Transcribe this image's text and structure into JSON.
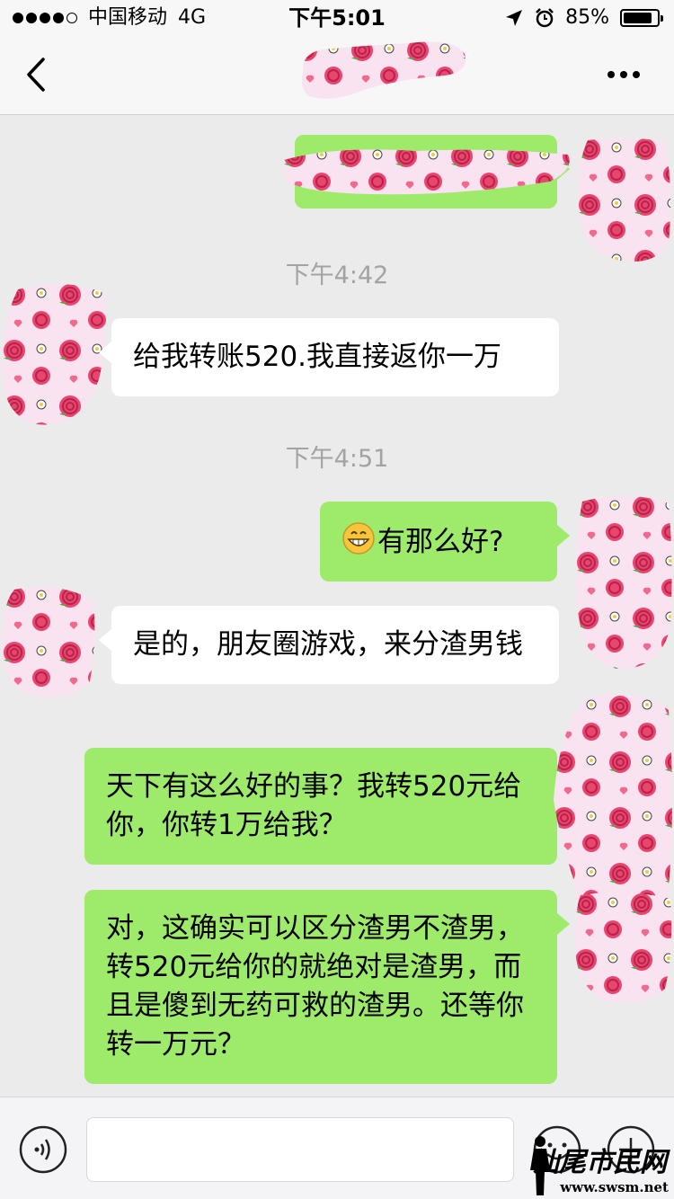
{
  "status_bar": {
    "carrier": "中国移动",
    "network": "4G",
    "time": "下午5:01",
    "battery": "85%",
    "battery_level": 0.85
  },
  "chat": {
    "time_1": "下午4:42",
    "msg_1": "给我转账520.我直接返你一万",
    "time_2": "下午4:51",
    "msg_2": "有那么好?",
    "msg_3": "是的，朋友圈游戏，来分渣男钱",
    "msg_4": "天下有这么好的事？我转520元给你，你转1万给我？",
    "msg_5": "对，这确实可以区分渣男不渣男，转520元给你的就绝对是渣男，而且是傻到无药可救的渣男。还等你转一万元？"
  },
  "input_bar": {
    "value": ""
  },
  "watermark": {
    "title": "汕尾市民网",
    "url": "www.swsm.net"
  },
  "icons": {
    "back": "chevron-left-icon",
    "more": "more-dots-icon",
    "voice": "voice-icon",
    "emoji": "emoji-icon",
    "plus": "plus-icon"
  },
  "colors": {
    "outgoing_bubble": "#9eea6a",
    "incoming_bubble": "#ffffff",
    "background": "#ebebeb",
    "blob_pink": "#f7dff0",
    "rose": "#e8456f"
  }
}
